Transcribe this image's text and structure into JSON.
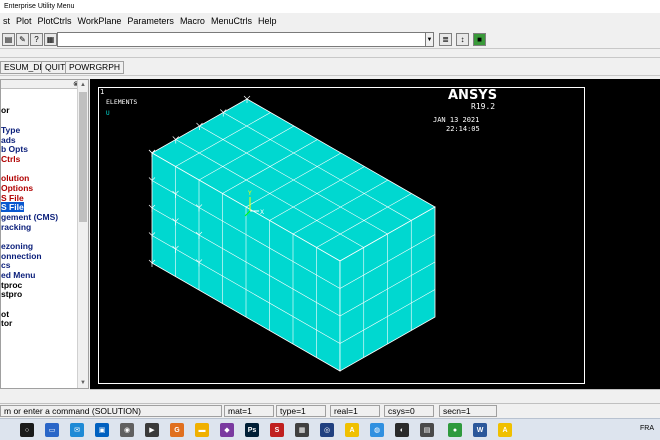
{
  "window": {
    "title": "Enterprise Utility Menu"
  },
  "menubar": [
    "st",
    "Plot",
    "PlotCtrls",
    "WorkPlane",
    "Parameters",
    "Macro",
    "MenuCtrls",
    "Help"
  ],
  "toolbar": {
    "command_value": ""
  },
  "toolstrip": [
    "ESUM_DB",
    "QUIT",
    "POWRGRPH"
  ],
  "left_panel": {
    "items": [
      {
        "label": "or",
        "color": "black"
      },
      {
        "label": "Type",
        "color": "dblue"
      },
      {
        "label": "ads",
        "color": "dblue"
      },
      {
        "label": "b Opts",
        "color": "dblue"
      },
      {
        "label": "Ctrls",
        "color": "red"
      },
      {
        "label": "olution",
        "color": "red"
      },
      {
        "label": "Options",
        "color": "red"
      },
      {
        "label": "S File",
        "color": "red"
      },
      {
        "label": "S File",
        "color": "selected"
      },
      {
        "label": "gement (CMS)",
        "color": "dblue"
      },
      {
        "label": "racking",
        "color": "dblue"
      },
      {
        "label": "ezoning",
        "color": "dblue"
      },
      {
        "label": "onnection",
        "color": "dblue"
      },
      {
        "label": "cs",
        "color": "dblue"
      },
      {
        "label": "ed Menu",
        "color": "dblue"
      },
      {
        "label": "tproc",
        "color": "black"
      },
      {
        "label": "stpro",
        "color": "black"
      },
      {
        "label": "ot",
        "color": "black"
      },
      {
        "label": "tor",
        "color": "black"
      }
    ]
  },
  "graphics": {
    "window_number": "1",
    "label": "ELEMENTS",
    "label_sub": "U",
    "brand": "ANSYS",
    "version": "R19.2",
    "date": "JAN 13 2021",
    "time": "22:14:05",
    "axis_y": "Y",
    "axis_x": "X",
    "axis_z": "Z",
    "mesh_color": "#00e0d8"
  },
  "statusbar": {
    "prompt": "m or enter a command (SOLUTION)",
    "mat": "mat=1",
    "type": "type=1",
    "real": "real=1",
    "csys": "csys=0",
    "secn": "secn=1"
  },
  "taskbar": {
    "lang": "FRA"
  }
}
